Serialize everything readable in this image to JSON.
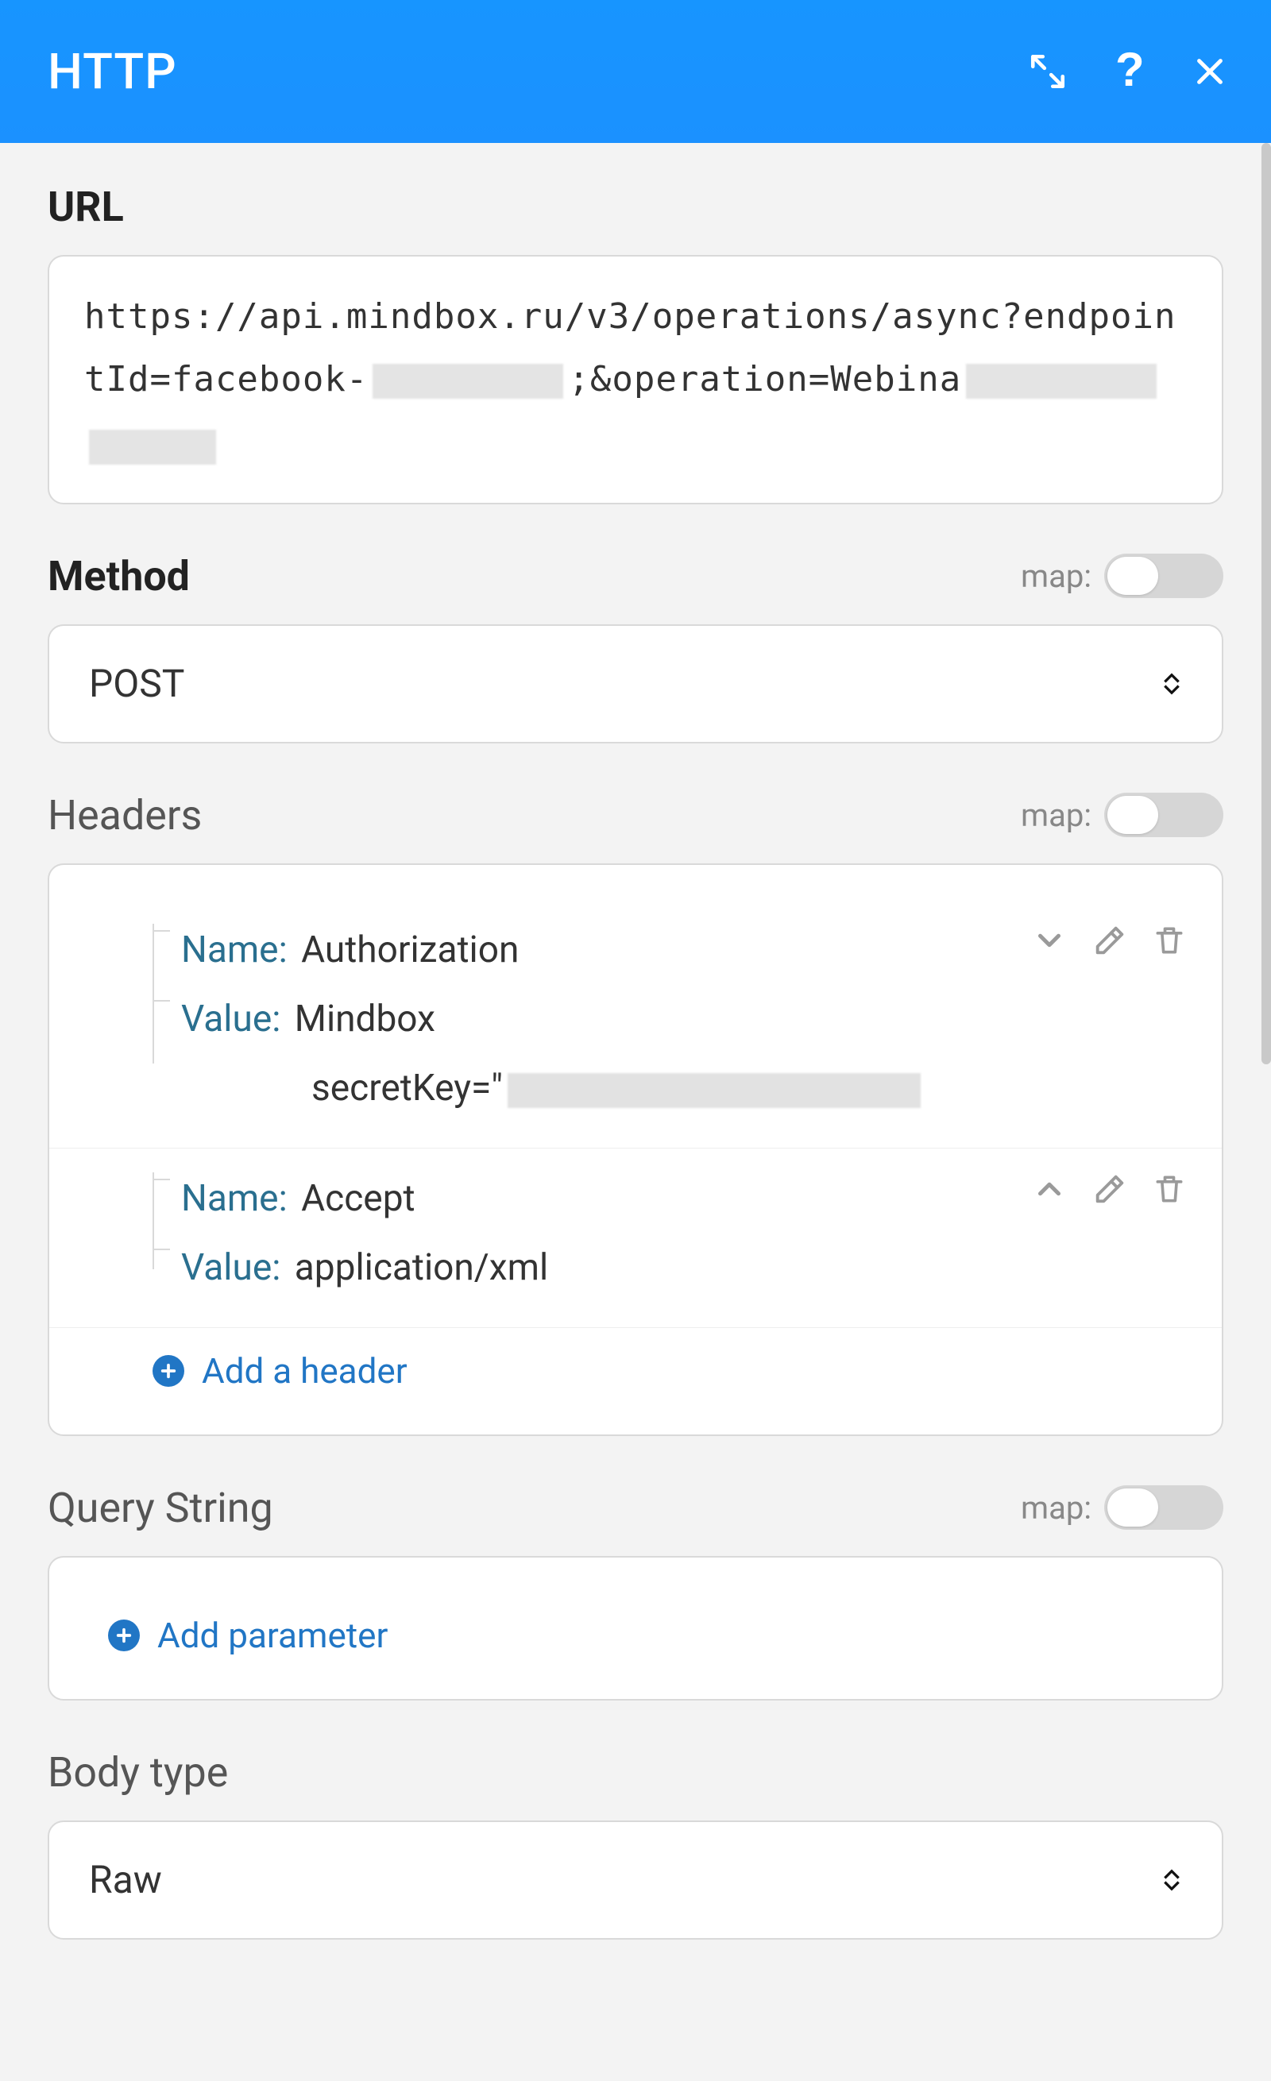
{
  "header": {
    "title": "HTTP"
  },
  "url": {
    "label": "URL",
    "value": "https://api.mindbox.ru/v3/operations/async?endpointId=facebook-",
    "value_tail": ";&operation=Webina"
  },
  "method": {
    "label": "Method",
    "mapLabel": "map:",
    "value": "POST"
  },
  "headersSection": {
    "label": "Headers",
    "mapLabel": "map:",
    "nameLabel": "Name:",
    "valueLabel": "Value:",
    "addLabel": "Add a header",
    "items": [
      {
        "name": "Authorization",
        "value": "Mindbox secretKey=\"",
        "redacted": true,
        "collapseDir": "down"
      },
      {
        "name": "Accept",
        "value": "application/xml",
        "redacted": false,
        "collapseDir": "up"
      }
    ]
  },
  "queryString": {
    "label": "Query String",
    "mapLabel": "map:",
    "addLabel": "Add parameter"
  },
  "bodyType": {
    "label": "Body type",
    "value": "Raw"
  }
}
